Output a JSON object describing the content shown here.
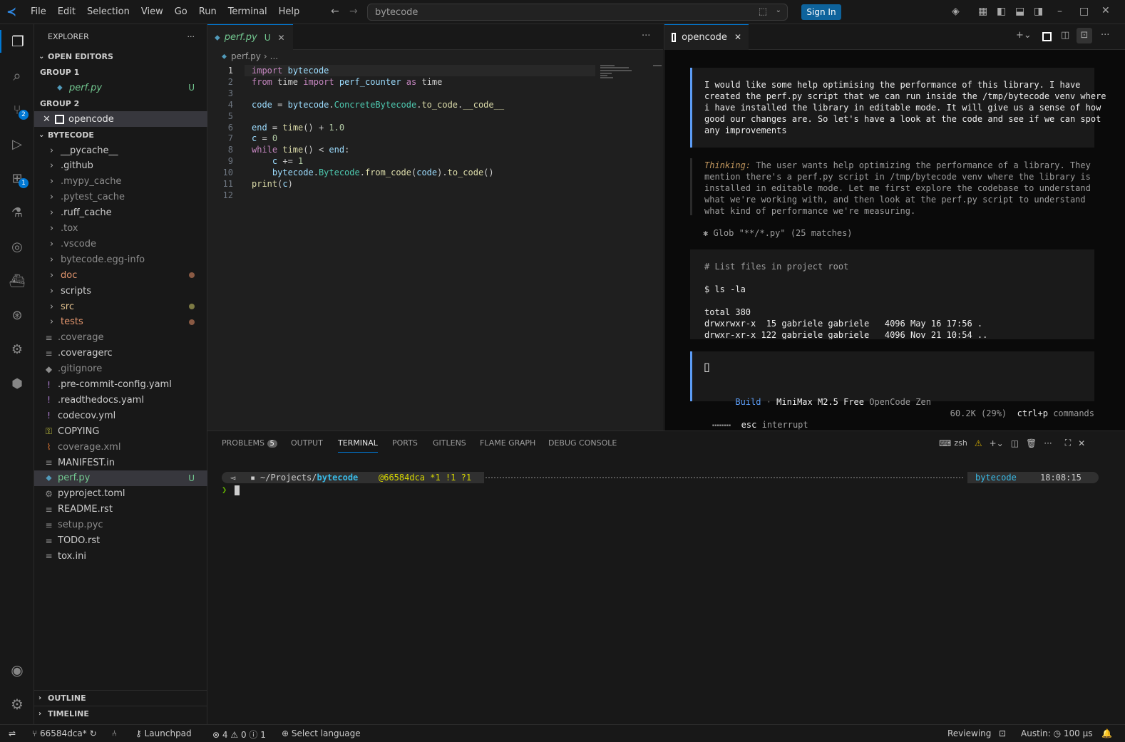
{
  "menu": [
    "File",
    "Edit",
    "Selection",
    "View",
    "Go",
    "Run",
    "Terminal",
    "Help"
  ],
  "titlebar": {
    "search": "bytecode",
    "sign_in": "Sign In"
  },
  "activity_badges": {
    "scm": "2",
    "extensions": "1"
  },
  "explorer": {
    "title": "EXPLORER",
    "open_editors": "OPEN EDITORS",
    "group1": "GROUP 1",
    "group1_file": "perf.py",
    "group1_status": "U",
    "group2": "GROUP 2",
    "group2_file": "opencode",
    "root": "BYTECODE",
    "items": [
      {
        "name": "__pycache__",
        "type": "folder",
        "color": "#cccccc"
      },
      {
        "name": ".github",
        "type": "folder",
        "color": "#cccccc"
      },
      {
        "name": ".mypy_cache",
        "type": "folder",
        "color": "#8c8c8c"
      },
      {
        "name": ".pytest_cache",
        "type": "folder",
        "color": "#8c8c8c"
      },
      {
        "name": ".ruff_cache",
        "type": "folder",
        "color": "#cccccc"
      },
      {
        "name": ".tox",
        "type": "folder",
        "color": "#8c8c8c"
      },
      {
        "name": ".vscode",
        "type": "folder",
        "color": "#8c8c8c"
      },
      {
        "name": "bytecode.egg-info",
        "type": "folder",
        "color": "#8c8c8c"
      },
      {
        "name": "doc",
        "type": "folder",
        "color": "#e2956d",
        "dot": "#8a5a44"
      },
      {
        "name": "scripts",
        "type": "folder",
        "color": "#cccccc"
      },
      {
        "name": "src",
        "type": "folder",
        "color": "#e2c08d",
        "dot": "#7d7a44"
      },
      {
        "name": "tests",
        "type": "folder",
        "color": "#e2956d",
        "dot": "#8a5a44"
      },
      {
        "name": ".coverage",
        "type": "file",
        "color": "#8c8c8c",
        "icon": "≡"
      },
      {
        "name": ".coveragerc",
        "type": "file",
        "color": "#cccccc",
        "icon": "≡"
      },
      {
        "name": ".gitignore",
        "type": "file",
        "color": "#8c8c8c",
        "icon": "◆"
      },
      {
        "name": ".pre-commit-config.yaml",
        "type": "file",
        "color": "#cccccc",
        "icon": "!"
      },
      {
        "name": ".readthedocs.yaml",
        "type": "file",
        "color": "#cccccc",
        "icon": "!"
      },
      {
        "name": "codecov.yml",
        "type": "file",
        "color": "#cccccc",
        "icon": "!"
      },
      {
        "name": "COPYING",
        "type": "file",
        "color": "#cccccc",
        "icon": "⚿"
      },
      {
        "name": "coverage.xml",
        "type": "file",
        "color": "#8c8c8c",
        "icon": "⌇"
      },
      {
        "name": "MANIFEST.in",
        "type": "file",
        "color": "#cccccc",
        "icon": "≡"
      },
      {
        "name": "perf.py",
        "type": "file",
        "color": "#73c991",
        "icon": "⬥",
        "status": "U",
        "selected": true
      },
      {
        "name": "pyproject.toml",
        "type": "file",
        "color": "#cccccc",
        "icon": "⚙"
      },
      {
        "name": "README.rst",
        "type": "file",
        "color": "#cccccc",
        "icon": "≡"
      },
      {
        "name": "setup.pyc",
        "type": "file",
        "color": "#8c8c8c",
        "icon": "≡"
      },
      {
        "name": "TODO.rst",
        "type": "file",
        "color": "#cccccc",
        "icon": "≡"
      },
      {
        "name": "tox.ini",
        "type": "file",
        "color": "#cccccc",
        "icon": "≡"
      }
    ],
    "outline": "OUTLINE",
    "timeline": "TIMELINE"
  },
  "editor": {
    "tab": "perf.py",
    "tab_status": "U",
    "breadcrumb_file": "perf.py",
    "breadcrumb_more": "...",
    "lines": [
      "import bytecode",
      "from time import perf_counter as time",
      "",
      "code = bytecode.ConcreteBytecode.to_code.__code__",
      "",
      "end = time() + 1.0",
      "c = 0",
      "while time() < end:",
      "    c += 1",
      "    bytecode.Bytecode.from_code(code).to_code()",
      "print(c)",
      ""
    ]
  },
  "opencode": {
    "tab": "opencode",
    "user_message": "I would like some help optimising the performance of this library. I have\ncreated the perf.py script that we can run inside the /tmp/bytecode venv where\ni have installed the library in editable mode. It will give us a sense of how\ngood our changes are. So let's have a look at the code and see if we can spot\nany improvements",
    "thinking_label": "Thinking:",
    "thinking_text": " The user wants help optimizing the performance of a library. They\nmention there's a perf.py script in /tmp/bytecode venv where the library is\ninstalled in editable mode. Let me first explore the codebase to understand\nwhat we're working with, and then look at the perf.py script to understand\nwhat kind of performance we're measuring.",
    "glob": "✱ Glob \"**/*.py\" (25 matches)",
    "tool_comment": "# List files in project root",
    "tool_cmd": "$ ls -la",
    "tool_output": "total 380\ndrwxrwxr-x  15 gabriele gabriele   4096 May 16 17:56 .\ndrwxr-xr-x 122 gabriele gabriele   4096 Nov 21 10:54 ..",
    "input_cursor": "▯",
    "mode": "Build",
    "model": "MiniMax M2.5 Free",
    "provider": "OpenCode Zen",
    "spinner": "⬝⬝⬝⬝⬝⬝⬝⬝",
    "esc": "esc",
    "interrupt": "interrupt",
    "tokens": "60.2K (29%)",
    "shortcut": "ctrl+p",
    "commands": "commands"
  },
  "panel": {
    "tabs": [
      "PROBLEMS",
      "OUTPUT",
      "TERMINAL",
      "PORTS",
      "GITLENS",
      "FLAME GRAPH",
      "DEBUG CONSOLE"
    ],
    "problems_count": "5",
    "shell": "zsh",
    "prompt_path_prefix": "~/Projects/",
    "prompt_path_dir": "bytecode",
    "prompt_git": "@66584dca *1 !1 ?1",
    "prompt_env": "bytecode",
    "prompt_time": "18:08:15",
    "prompt_char": "❯"
  },
  "status": {
    "branch": "66584dca*",
    "launchpad": "Launchpad",
    "errors": "4",
    "warnings": "0",
    "infos": "1",
    "language": "Select language",
    "reviewing": "Reviewing",
    "austin": "Austin:",
    "interval": "100 µs"
  },
  "colors": {
    "accent": "#0078d4",
    "modified": "#e2956d",
    "untracked": "#73c991"
  }
}
